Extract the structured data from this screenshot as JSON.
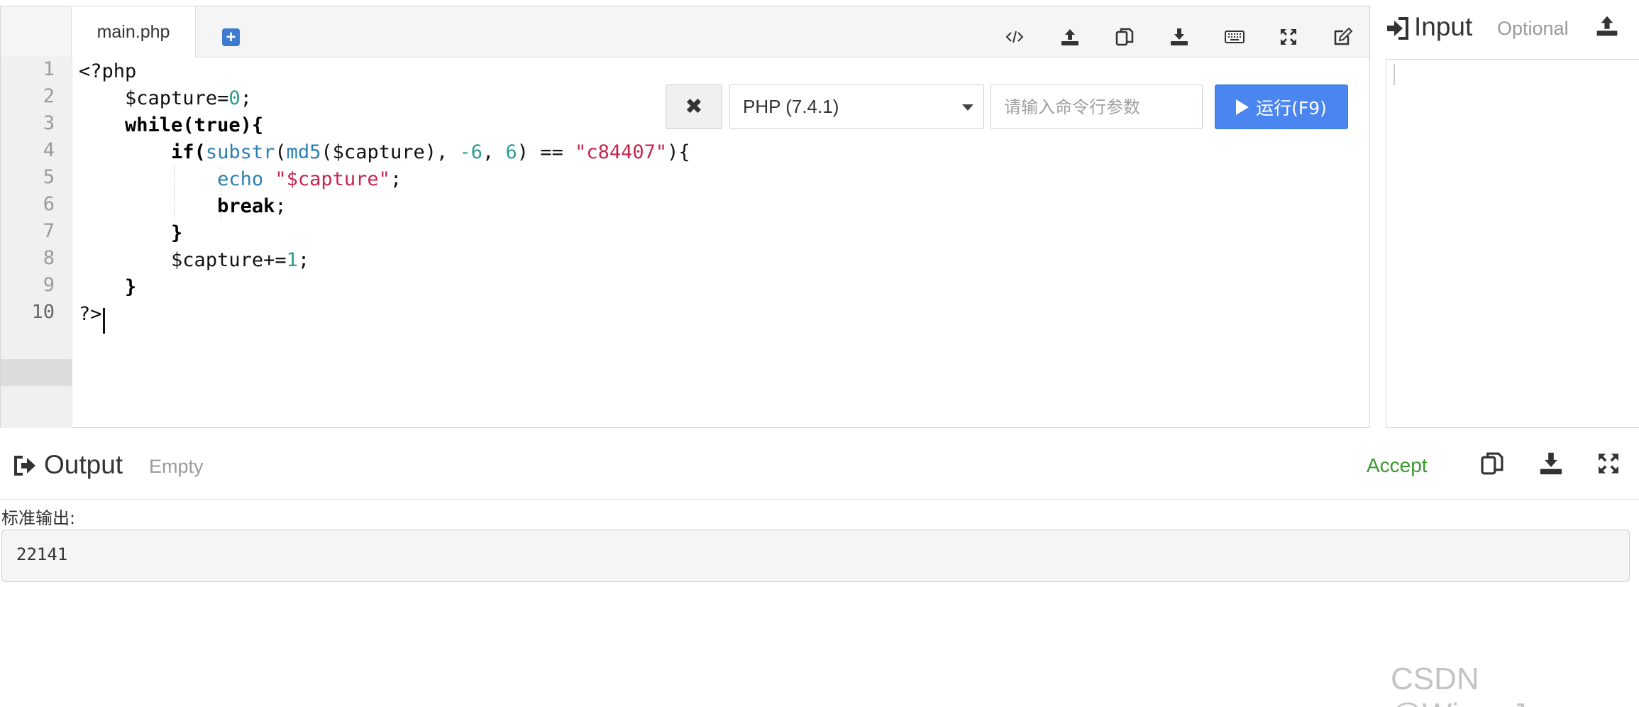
{
  "editor": {
    "tab_label": "main.php",
    "toolbar_icons": [
      "code-icon",
      "upload-icon",
      "copy-icon",
      "download-icon",
      "keyboard-icon",
      "fullscreen-icon",
      "edit-icon"
    ],
    "line_numbers": [
      "1",
      "2",
      "3",
      "4",
      "5",
      "6",
      "7",
      "8",
      "9",
      "10"
    ],
    "code_lines": [
      "<?php",
      "    $capture=0;",
      "    while(true){",
      "        if(substr(md5($capture), -6, 6) == \"c84407\"){",
      "            echo \"$capture\";",
      "            break;",
      "        }",
      "        $capture+=1;",
      "    }",
      "?>"
    ],
    "code_tokens": {
      "open_tag": "<?php",
      "var_capture": "$capture",
      "assign_zero": "=",
      "zero": "0",
      "semicolon": ";",
      "while_kw": "while",
      "true_kw": "(true){",
      "if_kw": "if",
      "paren_open": "(",
      "substr_fn": "substr",
      "md5_fn": "md5",
      "md5_arg": "($capture), ",
      "neg_six": "-6",
      "comma": ", ",
      "six": "6",
      "compare": ") == ",
      "hash_str": "\"c84407\"",
      "brace_open": "){",
      "echo_kw": "echo",
      "echo_str": "\"$capture\"",
      "break_kw": "break",
      "close_brace": "}",
      "increment": "$capture+=",
      "one": "1",
      "close_tag": "?>"
    },
    "active_line": "10",
    "clear_button_icon": "times-icon",
    "language_selected": "PHP (7.4.1)",
    "args_placeholder": "请输入命令行参数",
    "run_button_label": "运行(F9)"
  },
  "input_panel": {
    "title": "Input",
    "hint": "Optional",
    "value": ""
  },
  "output_panel": {
    "title": "Output",
    "status": "Empty",
    "result": "Accept",
    "stdout_label": "标准输出:",
    "stdout_value": "22141"
  },
  "colors": {
    "run_button": "#4a85f0",
    "accept": "#3a9a2f",
    "string": "#c7254e",
    "function": "#2c7fb3",
    "number": "#2a9d8f"
  },
  "watermark": "CSDN @Wine_Jar"
}
